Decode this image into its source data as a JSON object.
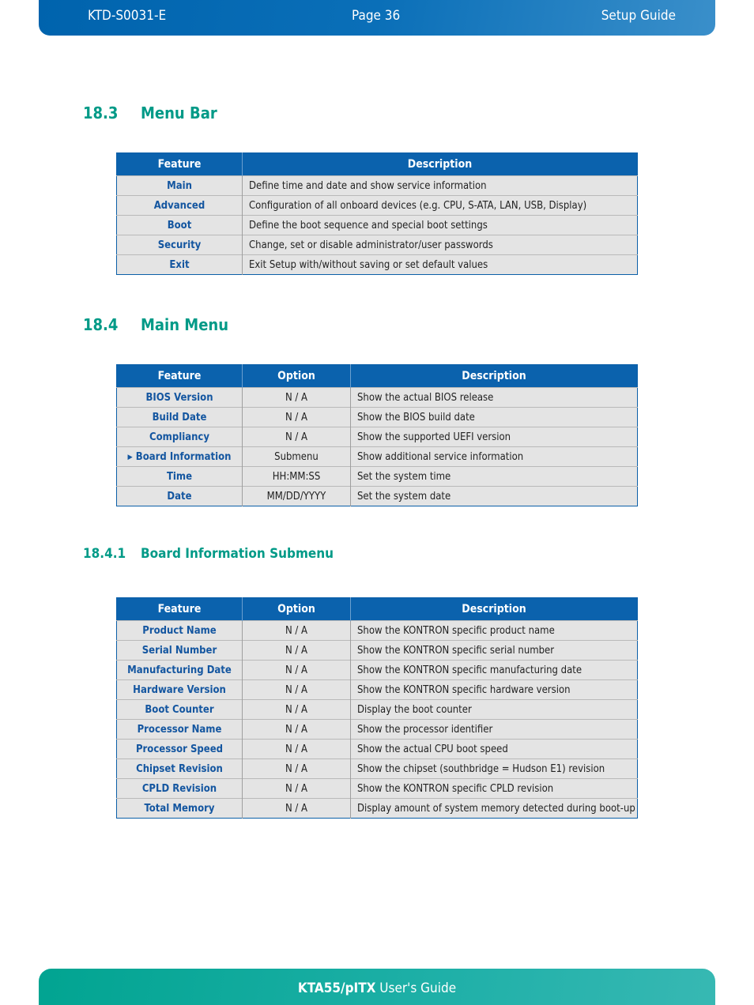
{
  "header": {
    "doc_id": "KTD-S0031-E",
    "page": "Page 36",
    "section": "Setup Guide"
  },
  "footer": {
    "product": "KTA55/pITX",
    "guide": " User's Guide"
  },
  "sections": {
    "menu_bar": {
      "number": "18.3",
      "title": "Menu Bar"
    },
    "main_menu": {
      "number": "18.4",
      "title": "Main Menu"
    },
    "board_info": {
      "number": "18.4.1",
      "title": "Board Information Submenu"
    }
  },
  "menu_bar_table": {
    "headers": [
      "Feature",
      "Description"
    ],
    "rows": [
      {
        "feature": "Main",
        "description": "Define time and date and show service information"
      },
      {
        "feature": "Advanced",
        "description": "Configuration of all onboard devices (e.g. CPU, S-ATA, LAN, USB, Display)"
      },
      {
        "feature": "Boot",
        "description": "Define the boot sequence  and special boot settings"
      },
      {
        "feature": "Security",
        "description": "Change, set or disable administrator/user passwords"
      },
      {
        "feature": "Exit",
        "description": "Exit Setup with/without saving or set default values"
      }
    ]
  },
  "main_menu_table": {
    "headers": [
      "Feature",
      "Option",
      "Description"
    ],
    "rows": [
      {
        "feature": "BIOS Version",
        "option": "N / A",
        "description": "Show the actual BIOS release"
      },
      {
        "feature": "Build Date",
        "option": "N / A",
        "description": "Show the BIOS build date"
      },
      {
        "feature": "Compliancy",
        "option": "N / A",
        "description": "Show the supported UEFI version"
      },
      {
        "feature": "Board Information",
        "option": "Submenu",
        "description": "Show additional service information",
        "submenu": true
      },
      {
        "feature": "Time",
        "option": "HH:MM:SS",
        "description": "Set the system time"
      },
      {
        "feature": "Date",
        "option": "MM/DD/YYYY",
        "description": "Set the system date"
      }
    ]
  },
  "board_info_table": {
    "headers": [
      "Feature",
      "Option",
      "Description"
    ],
    "rows": [
      {
        "feature": "Product Name",
        "option": "N / A",
        "description": "Show the KONTRON specific product name"
      },
      {
        "feature": "Serial Number",
        "option": "N / A",
        "description": "Show the KONTRON specific serial number"
      },
      {
        "feature": "Manufacturing Date",
        "option": "N / A",
        "description": "Show the KONTRON specific manufacturing date"
      },
      {
        "feature": "Hardware Version",
        "option": "N / A",
        "description": "Show the KONTRON specific hardware version"
      },
      {
        "feature": "Boot Counter",
        "option": "N / A",
        "description": "Display the boot counter"
      },
      {
        "feature": "Processor Name",
        "option": "N / A",
        "description": "Show the processor identifier"
      },
      {
        "feature": "Processor Speed",
        "option": "N / A",
        "description": "Show the actual CPU boot speed"
      },
      {
        "feature": "Chipset Revision",
        "option": "N / A",
        "description": "Show the chipset (southbridge = Hudson E1) revision"
      },
      {
        "feature": "CPLD Revision",
        "option": "N / A",
        "description": "Show the KONTRON specific CPLD revision"
      },
      {
        "feature": "Total Memory",
        "option": "N / A",
        "description": "Display amount of system memory detected during boot-up"
      }
    ]
  },
  "icons": {
    "submenu_arrow": "triangle-right-icon"
  }
}
